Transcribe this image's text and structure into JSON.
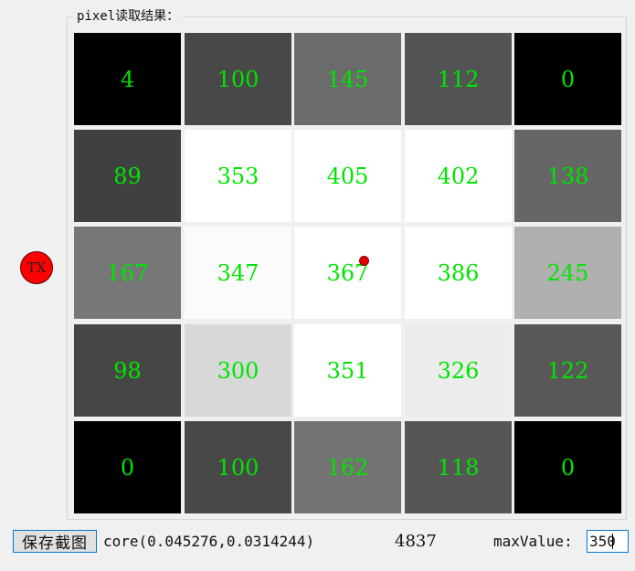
{
  "group": {
    "title": "pixel读取结果："
  },
  "grid": {
    "rows": [
      [
        {
          "value": "4",
          "color": "#000000"
        },
        {
          "value": "100",
          "color": "#484848"
        },
        {
          "value": "145",
          "color": "#6b6b6b"
        },
        {
          "value": "112",
          "color": "#535353"
        },
        {
          "value": "0",
          "color": "#000000"
        }
      ],
      [
        {
          "value": "89",
          "color": "#404040"
        },
        {
          "value": "353",
          "color": "#ffffff"
        },
        {
          "value": "405",
          "color": "#ffffff"
        },
        {
          "value": "402",
          "color": "#ffffff"
        },
        {
          "value": "138",
          "color": "#666666"
        }
      ],
      [
        {
          "value": "167",
          "color": "#777777"
        },
        {
          "value": "347",
          "color": "#fbfbfb"
        },
        {
          "value": "367",
          "color": "#ffffff"
        },
        {
          "value": "386",
          "color": "#ffffff"
        },
        {
          "value": "245",
          "color": "#b0b0b0"
        }
      ],
      [
        {
          "value": "98",
          "color": "#464646"
        },
        {
          "value": "300",
          "color": "#d8d8d8"
        },
        {
          "value": "351",
          "color": "#ffffff"
        },
        {
          "value": "326",
          "color": "#ececec"
        },
        {
          "value": "122",
          "color": "#585858"
        }
      ],
      [
        {
          "value": "0",
          "color": "#000000"
        },
        {
          "value": "100",
          "color": "#484848"
        },
        {
          "value": "162",
          "color": "#737373"
        },
        {
          "value": "118",
          "color": "#565656"
        },
        {
          "value": "0",
          "color": "#000000"
        }
      ]
    ],
    "text_color": "#00e500"
  },
  "marker": {
    "icon": "red-dot-marker",
    "row": 2,
    "col": 2,
    "color": "#e00000"
  },
  "tx_button": {
    "label": "TX",
    "color": "#ff0000"
  },
  "footer": {
    "save_label": "保存截图",
    "core_text": "core(0.045276,0.0314244)",
    "count": "4837",
    "max_label": "maxValue:",
    "max_value": "350"
  }
}
